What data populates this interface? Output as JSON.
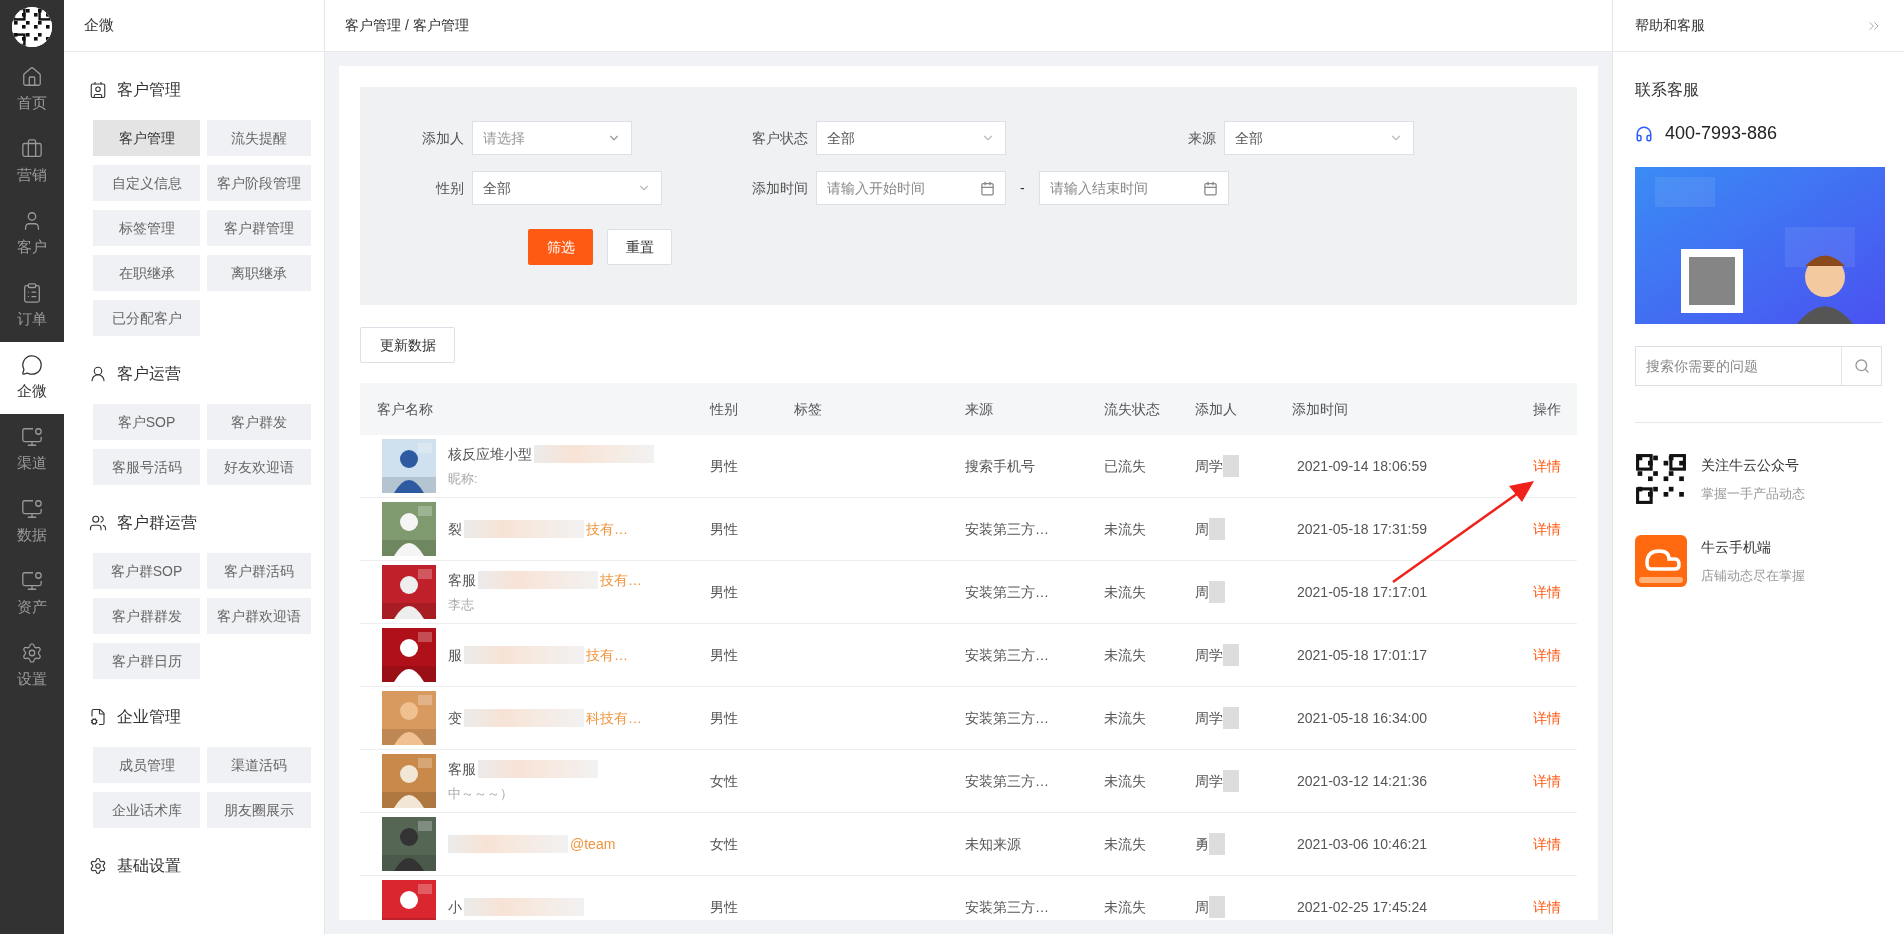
{
  "nav_rail": [
    {
      "label": "首页",
      "kind": "home",
      "selected": false
    },
    {
      "label": "营销",
      "kind": "bag",
      "selected": false
    },
    {
      "label": "客户",
      "kind": "user",
      "selected": false
    },
    {
      "label": "订单",
      "kind": "doc",
      "selected": false
    },
    {
      "label": "企微",
      "kind": "chat",
      "selected": true
    },
    {
      "label": "渠道",
      "kind": "chart",
      "selected": false
    },
    {
      "label": "数据",
      "kind": "chart",
      "selected": false
    },
    {
      "label": "资产",
      "kind": "chart",
      "selected": false
    },
    {
      "label": "设置",
      "kind": "gear",
      "selected": false
    }
  ],
  "sidebar": {
    "title": "企微",
    "sections": [
      {
        "title": "客户管理",
        "kind": "contact",
        "items": [
          {
            "label": "客户管理",
            "selected": true
          },
          {
            "label": "流失提醒",
            "selected": false
          },
          {
            "label": "自定义信息",
            "selected": false
          },
          {
            "label": "客户阶段管理",
            "selected": false
          },
          {
            "label": "标签管理",
            "selected": false
          },
          {
            "label": "客户群管理",
            "selected": false
          },
          {
            "label": "在职继承",
            "selected": false
          },
          {
            "label": "离职继承",
            "selected": false
          },
          {
            "label": "已分配客户",
            "selected": false
          }
        ]
      },
      {
        "title": "客户运营",
        "kind": "person",
        "items": [
          {
            "label": "客户SOP",
            "selected": false
          },
          {
            "label": "客户群发",
            "selected": false
          },
          {
            "label": "客服号活码",
            "selected": false
          },
          {
            "label": "好友欢迎语",
            "selected": false
          }
        ]
      },
      {
        "title": "客户群运营",
        "kind": "group",
        "items": [
          {
            "label": "客户群SOP",
            "selected": false
          },
          {
            "label": "客户群活码",
            "selected": false
          },
          {
            "label": "客户群群发",
            "selected": false
          },
          {
            "label": "客户群欢迎语",
            "selected": false
          },
          {
            "label": "客户群日历",
            "selected": false
          }
        ]
      },
      {
        "title": "企业管理",
        "kind": "file",
        "items": [
          {
            "label": "成员管理",
            "selected": false
          },
          {
            "label": "渠道活码",
            "selected": false
          },
          {
            "label": "企业话术库",
            "selected": false
          },
          {
            "label": "朋友圈展示",
            "selected": false
          }
        ]
      },
      {
        "title": "基础设置",
        "kind": "gear"
      }
    ]
  },
  "breadcrumb": "客户管理 / 客户管理",
  "filters": {
    "adder": {
      "label": "添加人",
      "placeholder": "请选择"
    },
    "status": {
      "label": "客户状态",
      "value": "全部"
    },
    "source": {
      "label": "来源",
      "value": "全部"
    },
    "gender": {
      "label": "性别",
      "value": "全部"
    },
    "time": {
      "label": "添加时间",
      "start_placeholder": "请输入开始时间",
      "separator": "-",
      "end_placeholder": "请输入结束时间"
    },
    "buttons": [
      "筛选",
      "重置"
    ]
  },
  "refresh_button": "更新数据",
  "table": {
    "columns": [
      "客户名称",
      "性别",
      "标签",
      "来源",
      "流失状态",
      "添加人",
      "添加时间",
      "操作"
    ],
    "rows": [
      {
        "name": "核反应堆小型",
        "org": "",
        "note": "昵称:",
        "gender": "男性",
        "source": "搜索手机号",
        "status": "已流失",
        "adder": "周学",
        "time": "2021-09-14 18:06:59",
        "action": "详情"
      },
      {
        "name": "裂",
        "org": "技有…",
        "note": "",
        "gender": "男性",
        "source": "安装第三方…",
        "status": "未流失",
        "adder": "周",
        "time": "2021-05-18 17:31:59",
        "action": "详情"
      },
      {
        "name": "客服",
        "org": "技有…",
        "note": "李志",
        "gender": "男性",
        "source": "安装第三方…",
        "status": "未流失",
        "adder": "周",
        "time": "2021-05-18 17:17:01",
        "action": "详情"
      },
      {
        "name": "服",
        "org": "技有…",
        "note": "",
        "gender": "男性",
        "source": "安装第三方…",
        "status": "未流失",
        "adder": "周学",
        "time": "2021-05-18 17:01:17",
        "action": "详情"
      },
      {
        "name": "变",
        "org": "科技有…",
        "note": "",
        "gender": "男性",
        "source": "安装第三方…",
        "status": "未流失",
        "adder": "周学",
        "time": "2021-05-18 16:34:00",
        "action": "详情"
      },
      {
        "name": "客服",
        "org": "",
        "note": "中～～～）",
        "gender": "女性",
        "source": "安装第三方…",
        "status": "未流失",
        "adder": "周学",
        "time": "2021-03-12 14:21:36",
        "action": "详情"
      },
      {
        "name": "",
        "org": "@team",
        "note": "",
        "gender": "女性",
        "source": "未知来源",
        "status": "未流失",
        "adder": "勇",
        "time": "2021-03-06 10:46:21",
        "action": "详情"
      },
      {
        "name": "小",
        "org": "",
        "note": "",
        "gender": "男性",
        "source": "安装第三方…",
        "status": "未流失",
        "adder": "周",
        "time": "2021-02-25 17:45:24",
        "action": "详情"
      }
    ]
  },
  "help": {
    "title": "帮助和客服",
    "contact_title": "联系客服",
    "phone": "400-7993-886",
    "search_placeholder": "搜索你需要的问题",
    "links": [
      {
        "kind": "qr",
        "title": "关注牛云公众号",
        "subtitle": "掌握一手产品动态"
      },
      {
        "kind": "app",
        "title": "牛云手机端",
        "subtitle": "店铺动态尽在掌握"
      }
    ]
  }
}
